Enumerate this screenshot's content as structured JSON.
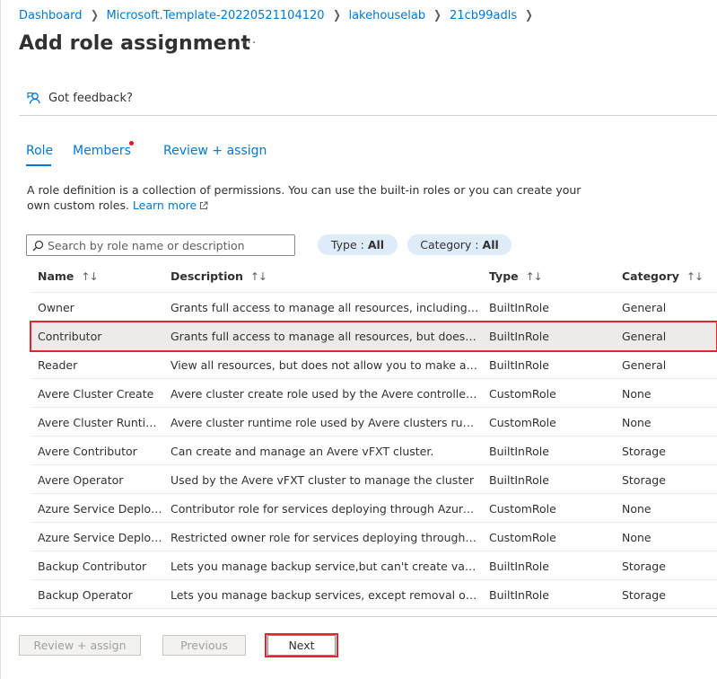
{
  "breadcrumb": [
    "Dashboard",
    "Microsoft.Template-20220521104120",
    "lakehouselab",
    "21cb99adls"
  ],
  "page": {
    "title": "Add role assignment",
    "more": "···"
  },
  "feedback": {
    "label": "Got feedback?"
  },
  "tabs": [
    {
      "label": "Role",
      "active": true
    },
    {
      "label": "Members",
      "has_dot": true
    },
    {
      "label": "Review + assign"
    }
  ],
  "description": {
    "text": "A role definition is a collection of permissions. You can use the built-in roles or you can create your own custom roles.",
    "link": "Learn more"
  },
  "search": {
    "placeholder": "Search by role name or description",
    "value": ""
  },
  "filters": {
    "type": {
      "label": "Type :",
      "value": "All"
    },
    "category": {
      "label": "Category :",
      "value": "All"
    }
  },
  "table": {
    "columns": [
      "Name",
      "Description",
      "Type",
      "Category"
    ],
    "sort_glyph": "↑↓",
    "rows": [
      {
        "name": "Owner",
        "description": "Grants full access to manage all resources, including the a...",
        "type": "BuiltInRole",
        "category": "General"
      },
      {
        "name": "Contributor",
        "description": "Grants full access to manage all resources, but does not all...",
        "type": "BuiltInRole",
        "category": "General",
        "selected": true
      },
      {
        "name": "Reader",
        "description": "View all resources, but does not allow you to make any ch...",
        "type": "BuiltInRole",
        "category": "General"
      },
      {
        "name": "Avere Cluster Create",
        "description": "Avere cluster create role used by the Avere controller to cr...",
        "type": "CustomRole",
        "category": "None"
      },
      {
        "name": "Avere Cluster Runtime...",
        "description": "Avere cluster runtime role used by Avere clusters running i...",
        "type": "CustomRole",
        "category": "None"
      },
      {
        "name": "Avere Contributor",
        "description": "Can create and manage an Avere vFXT cluster.",
        "type": "BuiltInRole",
        "category": "Storage"
      },
      {
        "name": "Avere Operator",
        "description": "Used by the Avere vFXT cluster to manage the cluster",
        "type": "BuiltInRole",
        "category": "Storage"
      },
      {
        "name": "Azure Service Deploy ...",
        "description": "Contributor role for services deploying through Azure Serv...",
        "type": "CustomRole",
        "category": "None"
      },
      {
        "name": "Azure Service Deploy ...",
        "description": "Restricted owner role for services deploying through Azure...",
        "type": "CustomRole",
        "category": "None"
      },
      {
        "name": "Backup Contributor",
        "description": "Lets you manage backup service,but can't create vaults an...",
        "type": "BuiltInRole",
        "category": "Storage"
      },
      {
        "name": "Backup Operator",
        "description": "Lets you manage backup services, except removal of backu...",
        "type": "BuiltInRole",
        "category": "Storage"
      }
    ]
  },
  "footer": {
    "review": "Review + assign",
    "previous": "Previous",
    "next": "Next"
  },
  "colors": {
    "accent": "#0078d4",
    "highlight": "#e3262e",
    "selected_row": "#edebe9",
    "pill": "#deecf9"
  }
}
